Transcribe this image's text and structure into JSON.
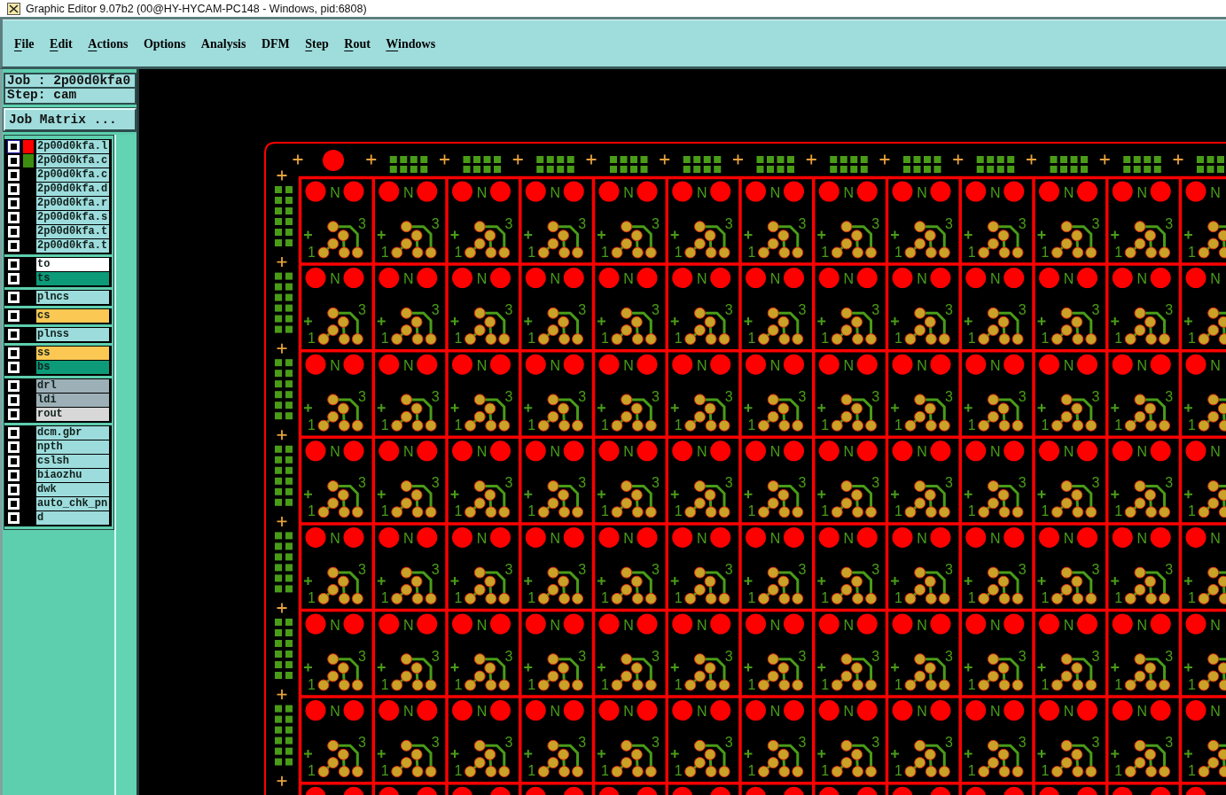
{
  "window": {
    "title": "Graphic Editor 9.07b2 (00@HY-HYCAM-PC148 - Windows, pid:6808)"
  },
  "menu": [
    {
      "label": "File",
      "mnemonic": true
    },
    {
      "label": "Edit",
      "mnemonic": true
    },
    {
      "label": "Actions",
      "mnemonic": true
    },
    {
      "label": "Options",
      "mnemonic": false
    },
    {
      "label": "Analysis",
      "mnemonic": false
    },
    {
      "label": "DFM",
      "mnemonic": false
    },
    {
      "label": "Step",
      "mnemonic": true
    },
    {
      "label": "Rout",
      "mnemonic": true
    },
    {
      "label": "Windows",
      "mnemonic": true
    }
  ],
  "job_panel": {
    "job": "Job : 2p00d0kfa0",
    "step": "Step: cam",
    "matrix_button": "Job Matrix ..."
  },
  "layers": {
    "groups": [
      {
        "items": [
          {
            "name": "2p00d0kfa.l",
            "kind": "document",
            "checked": false,
            "selected": true,
            "color": "#ff0000"
          },
          {
            "name": "2p00d0kfa.c",
            "kind": "document",
            "checked": false,
            "selected": false,
            "color": "#3c8c10"
          },
          {
            "name": "2p00d0kfa.c",
            "kind": "document",
            "checked": false,
            "selected": false
          },
          {
            "name": "2p00d0kfa.d",
            "kind": "document",
            "checked": false,
            "selected": false
          },
          {
            "name": "2p00d0kfa.r",
            "kind": "document",
            "checked": false,
            "selected": false
          },
          {
            "name": "2p00d0kfa.s",
            "kind": "document",
            "checked": false,
            "selected": false
          },
          {
            "name": "2p00d0kfa.t",
            "kind": "document",
            "checked": false,
            "selected": false
          },
          {
            "name": "2p00d0kfa.t",
            "kind": "document",
            "checked": false,
            "selected": false
          }
        ]
      },
      {
        "items": [
          {
            "name": "to",
            "kind": "silk_screen",
            "checked": false,
            "selected": false
          },
          {
            "name": "ts",
            "kind": "solder_mask",
            "checked": false,
            "selected": false
          }
        ]
      },
      {
        "items": [
          {
            "name": "plncs",
            "kind": "document",
            "checked": false,
            "selected": false
          }
        ]
      },
      {
        "items": [
          {
            "name": "cs",
            "kind": "signal",
            "checked": false,
            "selected": false
          }
        ]
      },
      {
        "items": [
          {
            "name": "plnss",
            "kind": "document",
            "checked": false,
            "selected": false
          }
        ]
      },
      {
        "items": [
          {
            "name": "ss",
            "kind": "signal",
            "checked": false,
            "selected": false
          },
          {
            "name": "bs",
            "kind": "solder_mask",
            "checked": false,
            "selected": false
          }
        ]
      },
      {
        "items": [
          {
            "name": "drl",
            "kind": "drill",
            "checked": false,
            "selected": false
          },
          {
            "name": "ldi",
            "kind": "drill",
            "checked": false,
            "selected": false
          },
          {
            "name": "rout",
            "kind": "rout",
            "checked": false,
            "selected": false
          }
        ]
      },
      {
        "items": [
          {
            "name": "dcm.gbr",
            "kind": "document",
            "checked": false,
            "selected": false
          },
          {
            "name": "npth",
            "kind": "document",
            "checked": false,
            "selected": false
          },
          {
            "name": "cslsh",
            "kind": "document",
            "checked": false,
            "selected": false
          },
          {
            "name": "biaozhu",
            "kind": "document",
            "checked": false,
            "selected": false
          },
          {
            "name": "dwk",
            "kind": "document",
            "checked": false,
            "selected": false
          },
          {
            "name": "auto_chk_pn",
            "kind": "document",
            "checked": false,
            "selected": false
          },
          {
            "name": "d",
            "kind": "document",
            "checked": false,
            "selected": false
          }
        ]
      }
    ]
  },
  "canvas": {
    "top_rail": [
      {
        "kind": "hole"
      },
      {
        "kind": "pads"
      },
      {
        "kind": "pads"
      },
      {
        "kind": "pads"
      },
      {
        "kind": "pads"
      },
      {
        "kind": "pads"
      },
      {
        "kind": "pads"
      },
      {
        "kind": "pads"
      },
      {
        "kind": "pads"
      },
      {
        "kind": "pads"
      },
      {
        "kind": "pads"
      },
      {
        "kind": "pads"
      },
      {
        "kind": "pads"
      }
    ],
    "left_rail": [
      {
        "kind": "pads"
      },
      {
        "kind": "pads"
      },
      {
        "kind": "pads"
      },
      {
        "kind": "pads"
      },
      {
        "kind": "pads"
      },
      {
        "kind": "pads"
      },
      {
        "kind": "pads"
      },
      {
        "kind": "cross"
      }
    ],
    "rows": [
      {
        "cells": [
          {
            "kind": "full",
            "mark": "N",
            "first_pin": "1",
            "last_pin": "3"
          },
          {
            "kind": "full",
            "mark": "N",
            "first_pin": "1",
            "last_pin": "3"
          },
          {
            "kind": "full",
            "mark": "N",
            "first_pin": "1",
            "last_pin": "3"
          },
          {
            "kind": "full",
            "mark": "N",
            "first_pin": "1",
            "last_pin": "3"
          },
          {
            "kind": "full",
            "mark": "N",
            "first_pin": "1",
            "last_pin": "3"
          },
          {
            "kind": "full",
            "mark": "N",
            "first_pin": "1",
            "last_pin": "3"
          },
          {
            "kind": "full",
            "mark": "N",
            "first_pin": "1",
            "last_pin": "3"
          },
          {
            "kind": "full",
            "mark": "N",
            "first_pin": "1",
            "last_pin": "3"
          },
          {
            "kind": "full",
            "mark": "N",
            "first_pin": "1",
            "last_pin": "3"
          },
          {
            "kind": "full",
            "mark": "N",
            "first_pin": "1",
            "last_pin": "3"
          },
          {
            "kind": "full",
            "mark": "N",
            "first_pin": "1",
            "last_pin": "3"
          },
          {
            "kind": "full",
            "mark": "N",
            "first_pin": "1",
            "last_pin": "3"
          },
          {
            "kind": "right_cut",
            "mark": "N",
            "first_pin": "1"
          }
        ]
      },
      {
        "cells": [
          {
            "kind": "full",
            "mark": "N",
            "first_pin": "1",
            "last_pin": "3"
          },
          {
            "kind": "full",
            "mark": "N",
            "first_pin": "1",
            "last_pin": "3"
          },
          {
            "kind": "full",
            "mark": "N",
            "first_pin": "1",
            "last_pin": "3"
          },
          {
            "kind": "full",
            "mark": "N",
            "first_pin": "1",
            "last_pin": "3"
          },
          {
            "kind": "full",
            "mark": "N",
            "first_pin": "1",
            "last_pin": "3"
          },
          {
            "kind": "full",
            "mark": "N",
            "first_pin": "1",
            "last_pin": "3"
          },
          {
            "kind": "full",
            "mark": "N",
            "first_pin": "1",
            "last_pin": "3"
          },
          {
            "kind": "full",
            "mark": "N",
            "first_pin": "1",
            "last_pin": "3"
          },
          {
            "kind": "full",
            "mark": "N",
            "first_pin": "1",
            "last_pin": "3"
          },
          {
            "kind": "full",
            "mark": "N",
            "first_pin": "1",
            "last_pin": "3"
          },
          {
            "kind": "full",
            "mark": "N",
            "first_pin": "1",
            "last_pin": "3"
          },
          {
            "kind": "full",
            "mark": "N",
            "first_pin": "1",
            "last_pin": "3"
          },
          {
            "kind": "right_cut",
            "mark": "N",
            "first_pin": "1"
          }
        ]
      },
      {
        "cells": [
          {
            "kind": "full",
            "mark": "N",
            "first_pin": "1",
            "last_pin": "3"
          },
          {
            "kind": "full",
            "mark": "N",
            "first_pin": "1",
            "last_pin": "3"
          },
          {
            "kind": "full",
            "mark": "N",
            "first_pin": "1",
            "last_pin": "3"
          },
          {
            "kind": "full",
            "mark": "N",
            "first_pin": "1",
            "last_pin": "3"
          },
          {
            "kind": "full",
            "mark": "N",
            "first_pin": "1",
            "last_pin": "3"
          },
          {
            "kind": "full",
            "mark": "N",
            "first_pin": "1",
            "last_pin": "3"
          },
          {
            "kind": "full",
            "mark": "N",
            "first_pin": "1",
            "last_pin": "3"
          },
          {
            "kind": "full",
            "mark": "N",
            "first_pin": "1",
            "last_pin": "3"
          },
          {
            "kind": "full",
            "mark": "N",
            "first_pin": "1",
            "last_pin": "3"
          },
          {
            "kind": "full",
            "mark": "N",
            "first_pin": "1",
            "last_pin": "3"
          },
          {
            "kind": "full",
            "mark": "N",
            "first_pin": "1",
            "last_pin": "3"
          },
          {
            "kind": "full",
            "mark": "N",
            "first_pin": "1",
            "last_pin": "3"
          },
          {
            "kind": "right_cut",
            "mark": "N",
            "first_pin": "1"
          }
        ]
      },
      {
        "cells": [
          {
            "kind": "full",
            "mark": "N",
            "first_pin": "1",
            "last_pin": "3"
          },
          {
            "kind": "full",
            "mark": "N",
            "first_pin": "1",
            "last_pin": "3"
          },
          {
            "kind": "full",
            "mark": "N",
            "first_pin": "1",
            "last_pin": "3"
          },
          {
            "kind": "full",
            "mark": "N",
            "first_pin": "1",
            "last_pin": "3"
          },
          {
            "kind": "full",
            "mark": "N",
            "first_pin": "1",
            "last_pin": "3"
          },
          {
            "kind": "full",
            "mark": "N",
            "first_pin": "1",
            "last_pin": "3"
          },
          {
            "kind": "full",
            "mark": "N",
            "first_pin": "1",
            "last_pin": "3"
          },
          {
            "kind": "full",
            "mark": "N",
            "first_pin": "1",
            "last_pin": "3"
          },
          {
            "kind": "full",
            "mark": "N",
            "first_pin": "1",
            "last_pin": "3"
          },
          {
            "kind": "full",
            "mark": "N",
            "first_pin": "1",
            "last_pin": "3"
          },
          {
            "kind": "full",
            "mark": "N",
            "first_pin": "1",
            "last_pin": "3"
          },
          {
            "kind": "full",
            "mark": "N",
            "first_pin": "1",
            "last_pin": "3"
          },
          {
            "kind": "right_cut",
            "mark": "N",
            "first_pin": "1"
          }
        ]
      },
      {
        "cells": [
          {
            "kind": "full",
            "mark": "N",
            "first_pin": "1",
            "last_pin": "3"
          },
          {
            "kind": "full",
            "mark": "N",
            "first_pin": "1",
            "last_pin": "3"
          },
          {
            "kind": "full",
            "mark": "N",
            "first_pin": "1",
            "last_pin": "3"
          },
          {
            "kind": "full",
            "mark": "N",
            "first_pin": "1",
            "last_pin": "3"
          },
          {
            "kind": "full",
            "mark": "N",
            "first_pin": "1",
            "last_pin": "3"
          },
          {
            "kind": "full",
            "mark": "N",
            "first_pin": "1",
            "last_pin": "3"
          },
          {
            "kind": "full",
            "mark": "N",
            "first_pin": "1",
            "last_pin": "3"
          },
          {
            "kind": "full",
            "mark": "N",
            "first_pin": "1",
            "last_pin": "3"
          },
          {
            "kind": "full",
            "mark": "N",
            "first_pin": "1",
            "last_pin": "3"
          },
          {
            "kind": "full",
            "mark": "N",
            "first_pin": "1",
            "last_pin": "3"
          },
          {
            "kind": "full",
            "mark": "N",
            "first_pin": "1",
            "last_pin": "3"
          },
          {
            "kind": "full",
            "mark": "N",
            "first_pin": "1",
            "last_pin": "3"
          },
          {
            "kind": "right_cut",
            "mark": "N",
            "first_pin": "1"
          }
        ]
      },
      {
        "cells": [
          {
            "kind": "full",
            "mark": "N",
            "first_pin": "1",
            "last_pin": "3"
          },
          {
            "kind": "full",
            "mark": "N",
            "first_pin": "1",
            "last_pin": "3"
          },
          {
            "kind": "full",
            "mark": "N",
            "first_pin": "1",
            "last_pin": "3"
          },
          {
            "kind": "full",
            "mark": "N",
            "first_pin": "1",
            "last_pin": "3"
          },
          {
            "kind": "full",
            "mark": "N",
            "first_pin": "1",
            "last_pin": "3"
          },
          {
            "kind": "full",
            "mark": "N",
            "first_pin": "1",
            "last_pin": "3"
          },
          {
            "kind": "full",
            "mark": "N",
            "first_pin": "1",
            "last_pin": "3"
          },
          {
            "kind": "full",
            "mark": "N",
            "first_pin": "1",
            "last_pin": "3"
          },
          {
            "kind": "full",
            "mark": "N",
            "first_pin": "1",
            "last_pin": "3"
          },
          {
            "kind": "full",
            "mark": "N",
            "first_pin": "1",
            "last_pin": "3"
          },
          {
            "kind": "full",
            "mark": "N",
            "first_pin": "1",
            "last_pin": "3"
          },
          {
            "kind": "full",
            "mark": "N",
            "first_pin": "1",
            "last_pin": "3"
          },
          {
            "kind": "right_cut",
            "mark": "N",
            "first_pin": "1"
          }
        ]
      },
      {
        "cells": [
          {
            "kind": "full",
            "mark": "N",
            "first_pin": "1",
            "last_pin": "3"
          },
          {
            "kind": "full",
            "mark": "N",
            "first_pin": "1",
            "last_pin": "3"
          },
          {
            "kind": "full",
            "mark": "N",
            "first_pin": "1",
            "last_pin": "3"
          },
          {
            "kind": "full",
            "mark": "N",
            "first_pin": "1",
            "last_pin": "3"
          },
          {
            "kind": "full",
            "mark": "N",
            "first_pin": "1",
            "last_pin": "3"
          },
          {
            "kind": "full",
            "mark": "N",
            "first_pin": "1",
            "last_pin": "3"
          },
          {
            "kind": "full",
            "mark": "N",
            "first_pin": "1",
            "last_pin": "3"
          },
          {
            "kind": "full",
            "mark": "N",
            "first_pin": "1",
            "last_pin": "3"
          },
          {
            "kind": "full",
            "mark": "N",
            "first_pin": "1",
            "last_pin": "3"
          },
          {
            "kind": "full",
            "mark": "N",
            "first_pin": "1",
            "last_pin": "3"
          },
          {
            "kind": "full",
            "mark": "N",
            "first_pin": "1",
            "last_pin": "3"
          },
          {
            "kind": "full",
            "mark": "N",
            "first_pin": "1",
            "last_pin": "3"
          },
          {
            "kind": "right_cut",
            "mark": "N",
            "first_pin": "1"
          }
        ]
      },
      {
        "cells": [
          {
            "kind": "bottom_cut"
          },
          {
            "kind": "bottom_cut"
          },
          {
            "kind": "bottom_cut"
          },
          {
            "kind": "bottom_cut"
          },
          {
            "kind": "bottom_cut"
          },
          {
            "kind": "bottom_cut"
          },
          {
            "kind": "bottom_cut"
          },
          {
            "kind": "bottom_cut"
          },
          {
            "kind": "bottom_cut"
          },
          {
            "kind": "bottom_cut"
          },
          {
            "kind": "bottom_cut"
          },
          {
            "kind": "bottom_cut"
          },
          {
            "kind": "corner_cut"
          }
        ]
      }
    ]
  }
}
